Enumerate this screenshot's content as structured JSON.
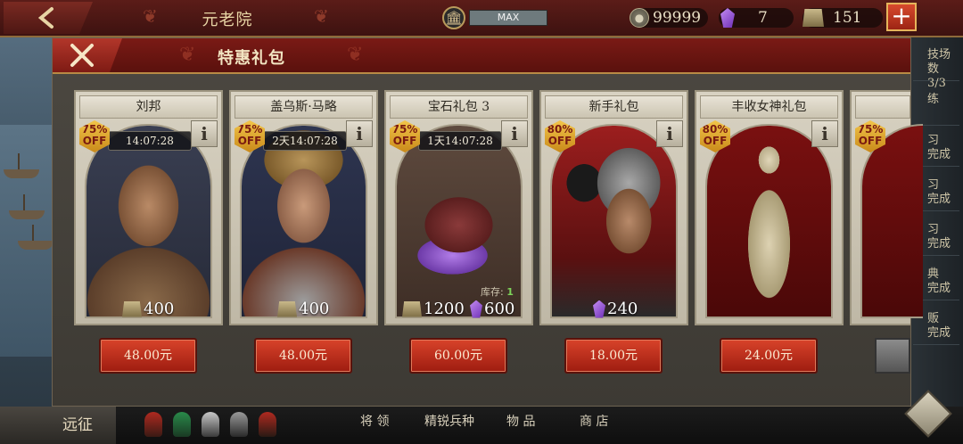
{
  "topbar": {
    "title": "元老院",
    "max_label": "MAX",
    "coins": "99999",
    "gems": "7",
    "bars": "151",
    "plus_label": "+"
  },
  "dialog": {
    "title": "特惠礼包",
    "close_label": "✕"
  },
  "cards": [
    {
      "title": "刘邦",
      "discount_pct": "75%",
      "discount_off": "OFF",
      "timer": "14:07:28",
      "reward_bars": "400",
      "price": "48.00元"
    },
    {
      "title": "盖乌斯·马略",
      "discount_pct": "75%",
      "discount_off": "OFF",
      "timer": "2天14:07:28",
      "reward_bars": "400",
      "price": "48.00元"
    },
    {
      "title": "宝石礼包 3",
      "discount_pct": "75%",
      "discount_off": "OFF",
      "timer": "1天14:07:28",
      "reward_bars": "1200",
      "reward_gems": "600",
      "stock_label": "库存:",
      "stock_value": "1",
      "price": "60.00元"
    },
    {
      "title": "新手礼包",
      "discount_pct": "80%",
      "discount_off": "OFF",
      "reward_gems": "240",
      "price": "18.00元"
    },
    {
      "title": "丰收女神礼包",
      "discount_pct": "80%",
      "discount_off": "OFF",
      "price": "24.00元"
    },
    {
      "title": "",
      "discount_pct": "75%",
      "discount_off": "OFF"
    }
  ],
  "info_label": "i",
  "side_panel": [
    "技场",
    "数 3/3",
    "练",
    "习",
    "完成",
    "习",
    "完成",
    "习",
    "完成",
    "典",
    "完成",
    "贩",
    "完成"
  ],
  "bottombar": {
    "expedition": "远征",
    "tabs": [
      "将 领",
      "精锐兵种",
      "物 品",
      "商 店"
    ]
  },
  "colors": {
    "header_red": "#7a1a15",
    "price_button": "#d8432a",
    "badge_gold": "#f2c54a",
    "card_bg": "#d8d2c2"
  }
}
